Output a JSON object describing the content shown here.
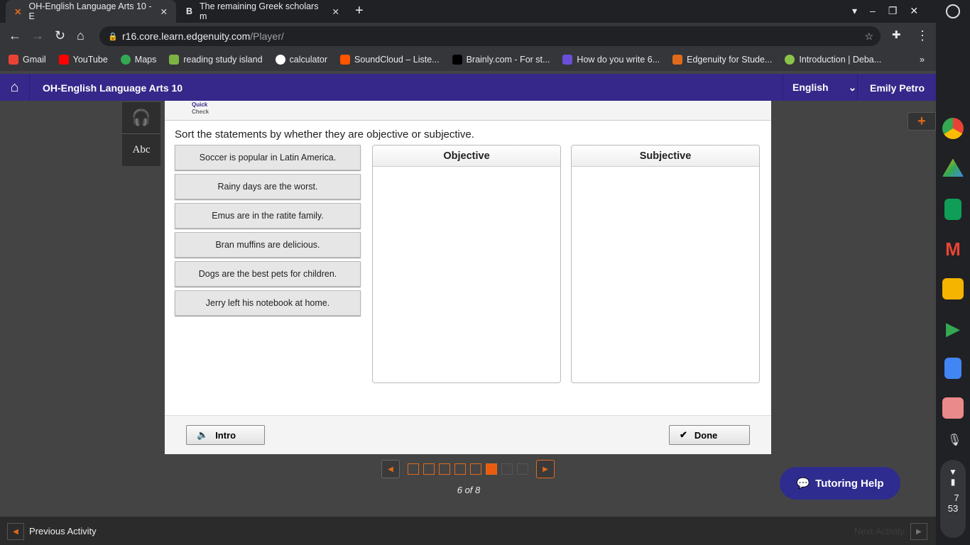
{
  "browser": {
    "tabs": [
      {
        "title": "OH-English Language Arts 10 - E"
      },
      {
        "title": "The remaining Greek scholars m"
      }
    ],
    "url_host": "r16.core.learn.edgenuity.com",
    "url_path": "/Player/",
    "bookmarks": [
      "Gmail",
      "YouTube",
      "Maps",
      "reading study island",
      "calculator",
      "SoundCloud – Liste...",
      "Brainly.com - For st...",
      "How do you write 6...",
      "Edgenuity for Stude...",
      "Introduction | Deba..."
    ]
  },
  "header": {
    "course": "OH-English Language Arts 10",
    "language": "English",
    "user": "Emily Petro"
  },
  "activity": {
    "badge_line1": "Quick",
    "badge_line2": "Check",
    "instruction": "Sort the statements by whether they are objective or subjective.",
    "statements": [
      "Soccer is popular in Latin America.",
      "Rainy days are the worst.",
      "Emus are in the ratite family.",
      "Bran muffins are delicious.",
      "Dogs are the best pets for children.",
      "Jerry left his notebook at home."
    ],
    "bins": [
      "Objective",
      "Subjective"
    ],
    "intro": "Intro",
    "done": "Done"
  },
  "pager": {
    "current": 6,
    "total": 8,
    "label": "6 of 8"
  },
  "tutoring": "Tutoring Help",
  "footer": {
    "prev": "Previous Activity",
    "next": "Next Activity"
  },
  "clock": {
    "hour": "7",
    "minute": "53"
  },
  "colors": {
    "header": "#35288a",
    "accent": "#e06a1b",
    "tutoring": "#2f2c8f"
  }
}
